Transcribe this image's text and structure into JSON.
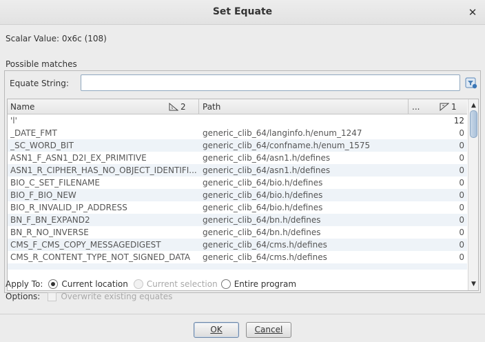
{
  "window": {
    "title": "Set Equate"
  },
  "scalar": {
    "text": "Scalar Value:  0x6c (108)"
  },
  "possible": {
    "label": "Possible matches",
    "equate_label": "Equate String:",
    "input_value": ""
  },
  "table": {
    "columns": {
      "name": "Name",
      "name_sort": "2",
      "path": "Path",
      "more": "...",
      "count_sort": "1"
    },
    "rows": [
      {
        "name": "'l'",
        "path": "",
        "count": "12"
      },
      {
        "name": "_DATE_FMT",
        "path": "generic_clib_64/langinfo.h/enum_1247",
        "count": "0"
      },
      {
        "name": "_SC_WORD_BIT",
        "path": "generic_clib_64/confname.h/enum_1575",
        "count": "0"
      },
      {
        "name": "ASN1_F_ASN1_D2I_EX_PRIMITIVE",
        "path": "generic_clib_64/asn1.h/defines",
        "count": "0"
      },
      {
        "name": "ASN1_R_CIPHER_HAS_NO_OBJECT_IDENTIFI...",
        "path": "generic_clib_64/asn1.h/defines",
        "count": "0"
      },
      {
        "name": "BIO_C_SET_FILENAME",
        "path": "generic_clib_64/bio.h/defines",
        "count": "0"
      },
      {
        "name": "BIO_F_BIO_NEW",
        "path": "generic_clib_64/bio.h/defines",
        "count": "0"
      },
      {
        "name": "BIO_R_INVALID_IP_ADDRESS",
        "path": "generic_clib_64/bio.h/defines",
        "count": "0"
      },
      {
        "name": "BN_F_BN_EXPAND2",
        "path": "generic_clib_64/bn.h/defines",
        "count": "0"
      },
      {
        "name": "BN_R_NO_INVERSE",
        "path": "generic_clib_64/bn.h/defines",
        "count": "0"
      },
      {
        "name": "CMS_F_CMS_COPY_MESSAGEDIGEST",
        "path": "generic_clib_64/cms.h/defines",
        "count": "0"
      },
      {
        "name": "CMS_R_CONTENT_TYPE_NOT_SIGNED_DATA",
        "path": "generic_clib_64/cms.h/defines",
        "count": "0"
      }
    ]
  },
  "apply": {
    "label": "Apply To:",
    "current_location": "Current location",
    "current_selection": "Current selection",
    "entire_program": "Entire program",
    "selected": "current_location"
  },
  "options": {
    "label": "Options:",
    "overwrite": "Overwrite existing equates"
  },
  "buttons": {
    "ok": "OK",
    "cancel": "Cancel"
  },
  "colors": {
    "row_alt": "#eef3f8",
    "accent": "#6d87a8"
  }
}
